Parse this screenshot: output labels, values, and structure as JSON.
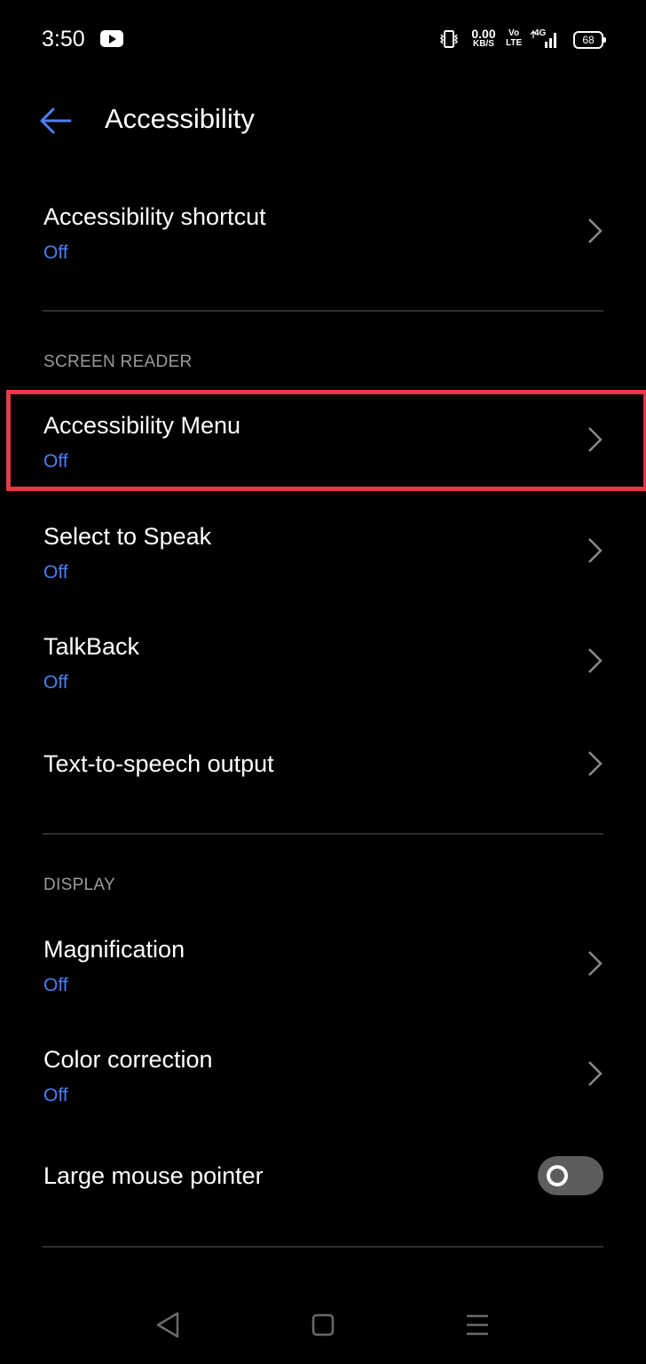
{
  "status_bar": {
    "time": "3:50",
    "net_speed_value": "0.00",
    "net_speed_unit": "KB/S",
    "volte_top": "Vo",
    "volte_bottom": "LTE",
    "network": "4G",
    "battery": "68"
  },
  "header": {
    "title": "Accessibility"
  },
  "items": [
    {
      "label": "Accessibility shortcut",
      "status": "Off"
    },
    {
      "label": "Accessibility Menu",
      "status": "Off"
    },
    {
      "label": "Select to Speak",
      "status": "Off"
    },
    {
      "label": "TalkBack",
      "status": "Off"
    },
    {
      "label": "Text-to-speech output"
    },
    {
      "label": "Magnification",
      "status": "Off"
    },
    {
      "label": "Color correction",
      "status": "Off"
    },
    {
      "label": "Large mouse pointer",
      "toggle_on": false
    }
  ],
  "sections": {
    "screen_reader": "SCREEN READER",
    "display": "DISPLAY"
  },
  "colors": {
    "accent": "#4d7ff0",
    "highlight": "#e23a4b",
    "background": "#000000"
  }
}
